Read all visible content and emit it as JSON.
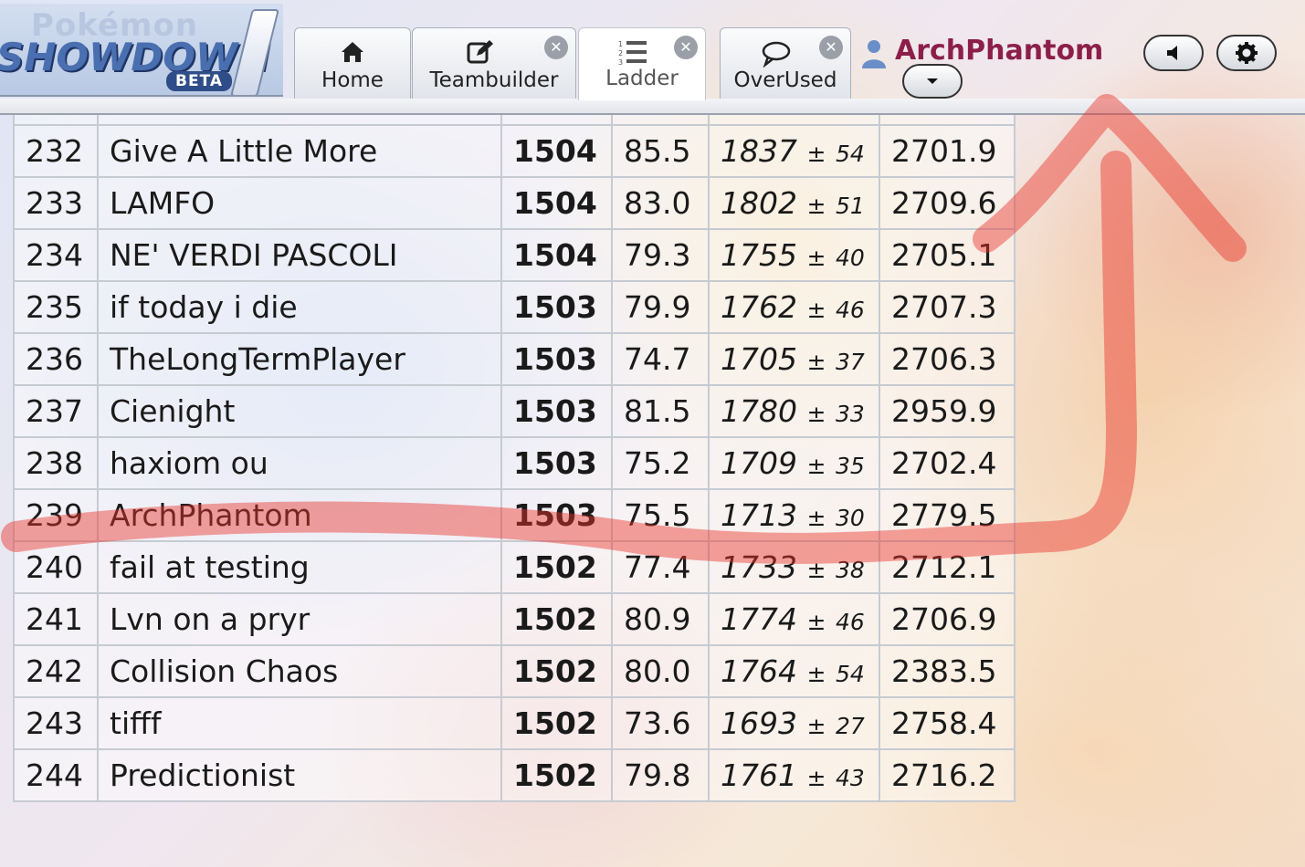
{
  "logo": {
    "line1": "Pokémon",
    "line2": "SHOWDOWN",
    "badge": "BETA",
    "bang": "!"
  },
  "tabs": [
    {
      "label": "Home",
      "icon": "home-icon",
      "closable": false
    },
    {
      "label": "Teambuilder",
      "icon": "pencil-icon",
      "closable": true
    },
    {
      "label": "Ladder",
      "icon": "list-icon",
      "closable": true,
      "active": true
    },
    {
      "label": "OverUsed",
      "icon": "chat-bubble-icon",
      "closable": true
    }
  ],
  "user": {
    "name": "ArchPhantom",
    "name_color": "#8c1f4a",
    "buttons": [
      "sound-icon",
      "gear-icon",
      "chevron-down-icon"
    ]
  },
  "ladder": {
    "rows": [
      {
        "rank": "232",
        "name": "Give A Little More",
        "elo": "1504",
        "gxe": "85.5",
        "glicko": "1837",
        "dev": "54",
        "coil": "2701.9"
      },
      {
        "rank": "233",
        "name": "LAMFO",
        "elo": "1504",
        "gxe": "83.0",
        "glicko": "1802",
        "dev": "51",
        "coil": "2709.6"
      },
      {
        "rank": "234",
        "name": "NE' VERDI PASCOLI",
        "elo": "1504",
        "gxe": "79.3",
        "glicko": "1755",
        "dev": "40",
        "coil": "2705.1"
      },
      {
        "rank": "235",
        "name": "if today i die",
        "elo": "1503",
        "gxe": "79.9",
        "glicko": "1762",
        "dev": "46",
        "coil": "2707.3"
      },
      {
        "rank": "236",
        "name": "TheLongTermPlayer",
        "elo": "1503",
        "gxe": "74.7",
        "glicko": "1705",
        "dev": "37",
        "coil": "2706.3"
      },
      {
        "rank": "237",
        "name": "Cienight",
        "elo": "1503",
        "gxe": "81.5",
        "glicko": "1780",
        "dev": "33",
        "coil": "2959.9"
      },
      {
        "rank": "238",
        "name": "haxiom ou",
        "elo": "1503",
        "gxe": "75.2",
        "glicko": "1709",
        "dev": "35",
        "coil": "2702.4"
      },
      {
        "rank": "239",
        "name": "ArchPhantom",
        "elo": "1503",
        "gxe": "75.5",
        "glicko": "1713",
        "dev": "30",
        "coil": "2779.5"
      },
      {
        "rank": "240",
        "name": "fail at testing",
        "elo": "1502",
        "gxe": "77.4",
        "glicko": "1733",
        "dev": "38",
        "coil": "2712.1"
      },
      {
        "rank": "241",
        "name": "Lvn on a pryr",
        "elo": "1502",
        "gxe": "80.9",
        "glicko": "1774",
        "dev": "46",
        "coil": "2706.9"
      },
      {
        "rank": "242",
        "name": "Collision Chaos",
        "elo": "1502",
        "gxe": "80.0",
        "glicko": "1764",
        "dev": "54",
        "coil": "2383.5"
      },
      {
        "rank": "243",
        "name": "tifff",
        "elo": "1502",
        "gxe": "73.6",
        "glicko": "1693",
        "dev": "27",
        "coil": "2758.4"
      },
      {
        "rank": "244",
        "name": "Predictionist",
        "elo": "1502",
        "gxe": "79.8",
        "glicko": "1761",
        "dev": "43",
        "coil": "2716.2"
      }
    ],
    "pm_symbol": "±"
  },
  "annotation": {
    "color": "#e8332b",
    "shape": "underline-with-up-arrow"
  }
}
